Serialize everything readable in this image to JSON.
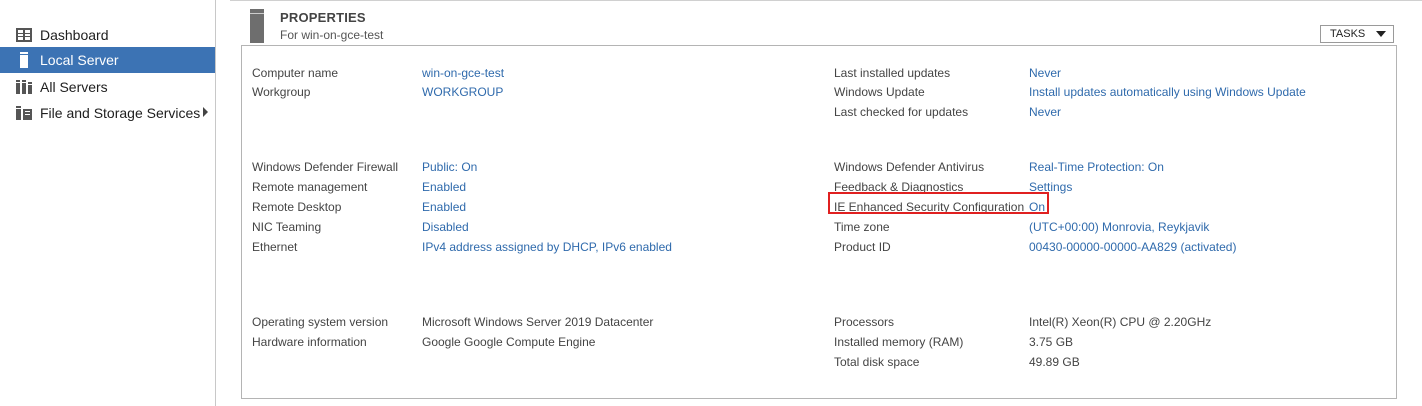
{
  "sidebar": {
    "items": [
      {
        "label": "Dashboard",
        "icon": "dashboard-icon"
      },
      {
        "label": "Local Server",
        "icon": "server-icon",
        "active": true
      },
      {
        "label": "All Servers",
        "icon": "servers-icon"
      },
      {
        "label": "File and Storage Services",
        "icon": "storage-icon",
        "has_submenu": true
      }
    ]
  },
  "properties": {
    "title": "PROPERTIES",
    "subtitle": "For win-on-gce-test",
    "tasks_label": "TASKS"
  },
  "left_group_1": [
    {
      "label": "Computer name",
      "value": "win-on-gce-test"
    },
    {
      "label": "Workgroup",
      "value": "WORKGROUP"
    }
  ],
  "right_group_1": [
    {
      "label": "Last installed updates",
      "value": "Never"
    },
    {
      "label": "Windows Update",
      "value": "Install updates automatically using Windows Update"
    },
    {
      "label": "Last checked for updates",
      "value": "Never"
    }
  ],
  "left_group_2": [
    {
      "label": "Windows Defender Firewall",
      "value": "Public: On"
    },
    {
      "label": "Remote management",
      "value": "Enabled"
    },
    {
      "label": "Remote Desktop",
      "value": "Enabled"
    },
    {
      "label": "NIC Teaming",
      "value": "Disabled"
    },
    {
      "label": "Ethernet",
      "value": "IPv4 address assigned by DHCP, IPv6 enabled"
    }
  ],
  "right_group_2": [
    {
      "label": "Windows Defender Antivirus",
      "value": "Real-Time Protection: On"
    },
    {
      "label": "Feedback & Diagnostics",
      "value": "Settings"
    },
    {
      "label": "IE Enhanced Security Configuration",
      "value": "On"
    },
    {
      "label": "Time zone",
      "value": "(UTC+00:00) Monrovia, Reykjavik"
    },
    {
      "label": "Product ID",
      "value": "00430-00000-00000-AA829 (activated)"
    }
  ],
  "left_group_3": [
    {
      "label": "Operating system version",
      "value": "Microsoft Windows Server 2019 Datacenter"
    },
    {
      "label": "Hardware information",
      "value": "Google Google Compute Engine"
    }
  ],
  "right_group_3": [
    {
      "label": "Processors",
      "value": "Intel(R) Xeon(R) CPU @ 2.20GHz"
    },
    {
      "label": "Installed memory (RAM)",
      "value": "3.75 GB"
    },
    {
      "label": "Total disk space",
      "value": "49.89 GB"
    }
  ],
  "colors": {
    "accent": "#3c73b4",
    "link": "#2f6aac",
    "highlight_box": "#e02020"
  }
}
